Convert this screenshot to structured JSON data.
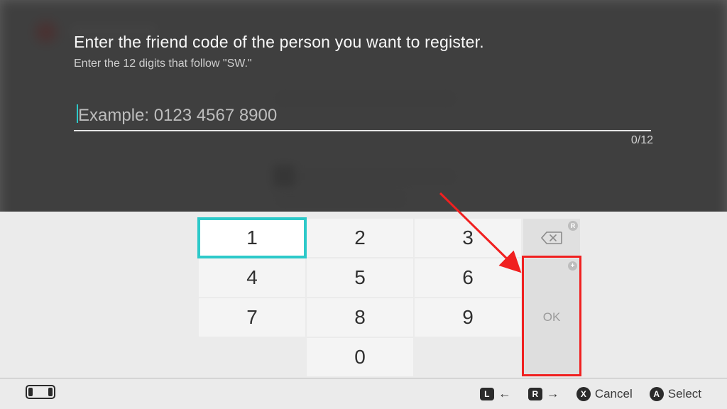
{
  "header": {
    "title": "Enter the friend code of the person you want to register.",
    "subtitle": "Enter the 12 digits that follow \"SW.\""
  },
  "input": {
    "value": "",
    "placeholder": "Example: 0123 4567 8900",
    "counter": "0/12"
  },
  "keypad": {
    "keys": [
      "1",
      "2",
      "3",
      "4",
      "5",
      "6",
      "7",
      "8",
      "9",
      "0"
    ],
    "selected_index": 0,
    "ok_label": "OK",
    "backspace_badge": "R",
    "ok_badge": "+"
  },
  "footer": {
    "l_label": "L",
    "r_label": "R",
    "x_label": "X",
    "a_label": "A",
    "left_arrow": "←",
    "right_arrow": "→",
    "cancel": "Cancel",
    "select": "Select"
  },
  "annotation": {
    "arrow_color": "#f02020"
  }
}
